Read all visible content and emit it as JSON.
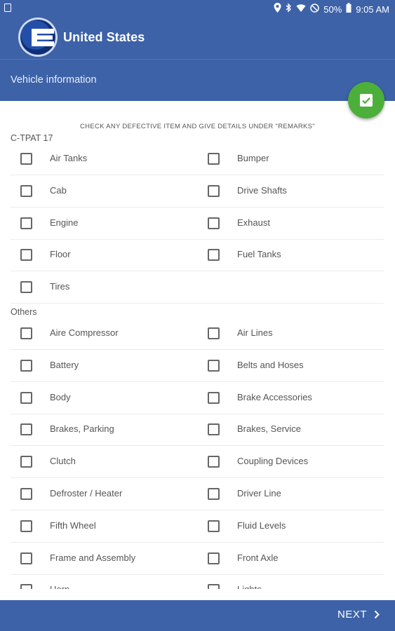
{
  "status_bar": {
    "battery": "50%",
    "time": "9:05 AM"
  },
  "app_bar": {
    "title": "United States"
  },
  "sub_bar": {
    "title": "Vehicle information"
  },
  "form": {
    "instruction": "CHECK ANY DEFECTIVE ITEM AND GIVE DETAILS UNDER \"REMARKS\"",
    "sections": [
      {
        "label": "C-TPAT 17",
        "rows": [
          [
            "Air Tanks",
            "Bumper"
          ],
          [
            "Cab",
            "Drive Shafts"
          ],
          [
            "Engine",
            "Exhaust"
          ],
          [
            "Floor",
            "Fuel Tanks"
          ],
          [
            "Tires",
            ""
          ]
        ]
      },
      {
        "label": "Others",
        "rows": [
          [
            "Aire Compressor",
            "Air Lines"
          ],
          [
            "Battery",
            "Belts and Hoses"
          ],
          [
            "Body",
            "Brake Accessories"
          ],
          [
            "Brakes, Parking",
            "Brakes, Service"
          ],
          [
            "Clutch",
            "Coupling Devices"
          ],
          [
            "Defroster / Heater",
            "Driver Line"
          ],
          [
            "Fifth Wheel",
            "Fluid Levels"
          ],
          [
            "Frame and Assembly",
            "Front Axle"
          ],
          [
            "Horn",
            "Lights"
          ]
        ]
      }
    ]
  },
  "footer": {
    "next_label": "NEXT"
  },
  "colors": {
    "primary": "#3d62a8",
    "fab": "#4caf3a"
  }
}
